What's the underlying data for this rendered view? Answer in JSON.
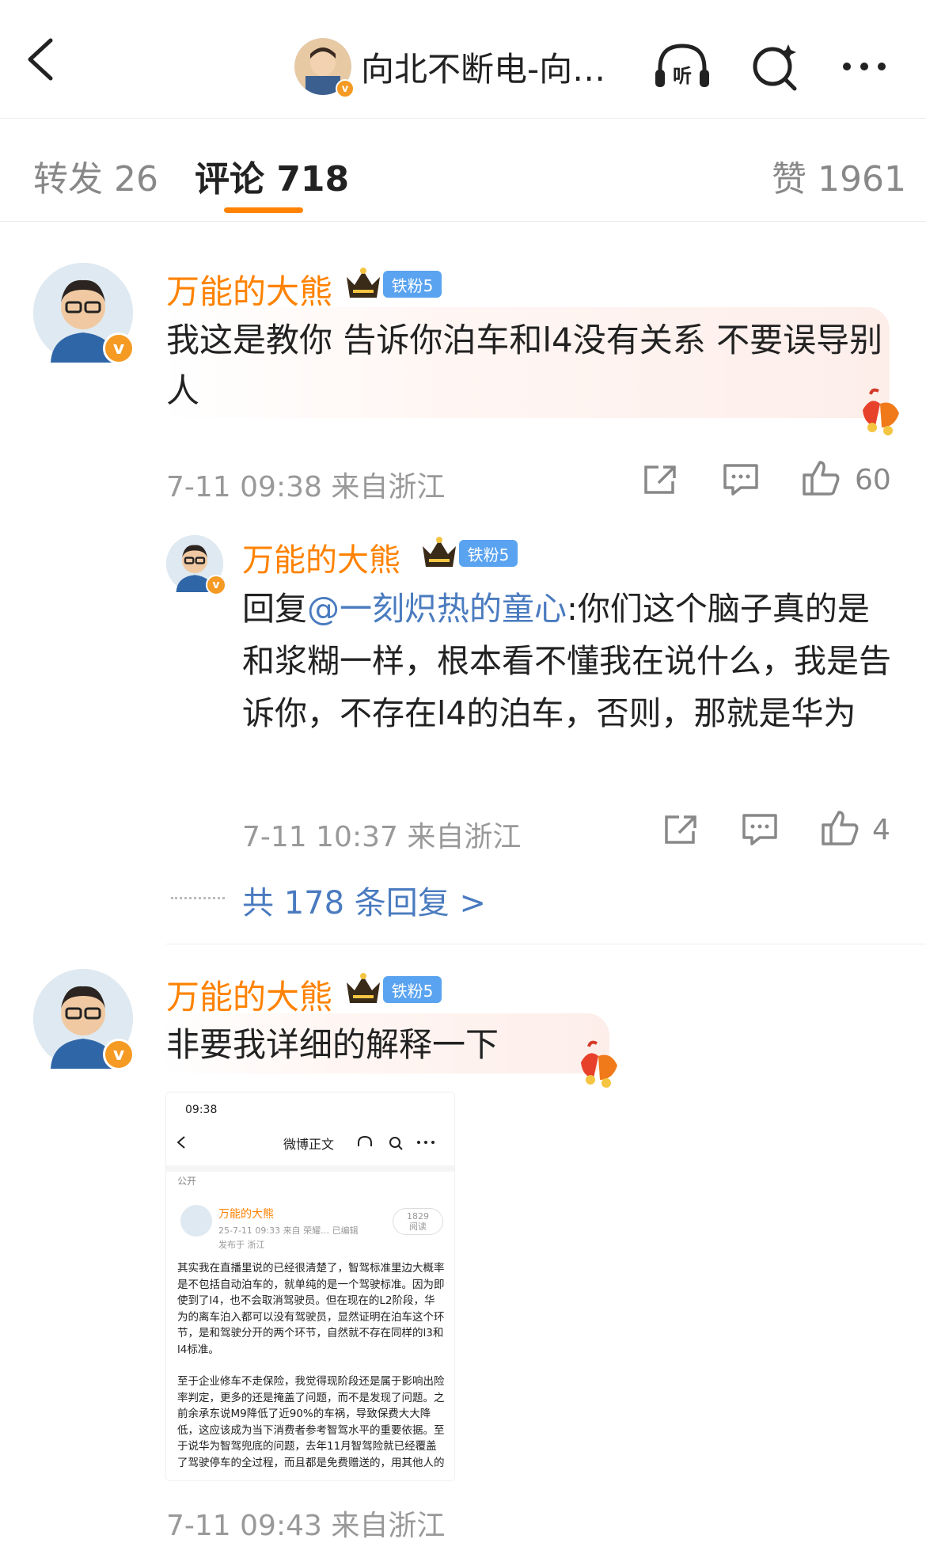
{
  "header": {
    "back_icon": "chevron-left-icon",
    "title": "向北不断电-向…",
    "listen_icon": "headphones-listen-icon",
    "listen_label": "听",
    "search_icon": "search-sparkle-icon",
    "more_icon": "more-dots-icon"
  },
  "tabs": {
    "repost": "转发 26",
    "comments": "评论 718",
    "likes": "赞 1961"
  },
  "comments": [
    {
      "user": "万能的大熊",
      "fan_badge": "铁粉5",
      "text": "我这是教你 告诉你泊车和l4没有关系 不要误导别人",
      "time": "7-11 09:38 来自浙江",
      "likes": "60",
      "reply": {
        "user": "万能的大熊",
        "fan_badge": "铁粉5",
        "prefix": "回复",
        "mention": "@一刻炽热的童心",
        "text": ":你们这个脑子真的是和浆糊一样，根本看不懂我在说什么，我是告诉你，不存在l4的泊车，否则，那就是华为",
        "time": "7-11 10:37 来自浙江",
        "likes": "4"
      },
      "more_replies": "共 178 条回复 >"
    },
    {
      "user": "万能的大熊",
      "fan_badge": "铁粉5",
      "text": "非要我详细的解释一下",
      "time": "7-11 09:43 来自浙江"
    }
  ],
  "embedded_screenshot": {
    "status": "09:38",
    "nav_title": "微博正文",
    "visibility": "公开",
    "user": "万能的大熊",
    "time": "25-7-11 09:33 来自 荣耀… 已编辑",
    "location": "发布于 浙江",
    "reads": "1829",
    "reads_label": "阅读",
    "para1": "其实我在直播里说的已经很清楚了，智驾标准里边大概率是不包括自动泊车的，就单纯的是一个驾驶标准。因为即使到了l4，也不会取消驾驶员。但在现在的L2阶段，华为的离车泊入都可以没有驾驶员，显然证明在泊车这个环节，是和驾驶分开的两个环节，自然就不存在同样的l3和l4标准。",
    "para2": "至于企业修车不走保险，我觉得现阶段还是属于影响出险率判定，更多的还是掩盖了问题，而不是发现了问题。之前余承东说M9降低了近90%的车祸，导致保费大大降低，这应该成为当下消费者参考智驾水平的重要依据。至于说华为智驾兜底的问题，去年11月智驾险就已经覆盖了驾驶停车的全过程，而且都是免费赠送的，用其他人的"
  },
  "colors": {
    "username": "#ff8200",
    "tab_underline": "#ff8200",
    "mention": "#4a7bbf",
    "fan_badge": "#5aa3f0",
    "verified": "#f59a23"
  }
}
